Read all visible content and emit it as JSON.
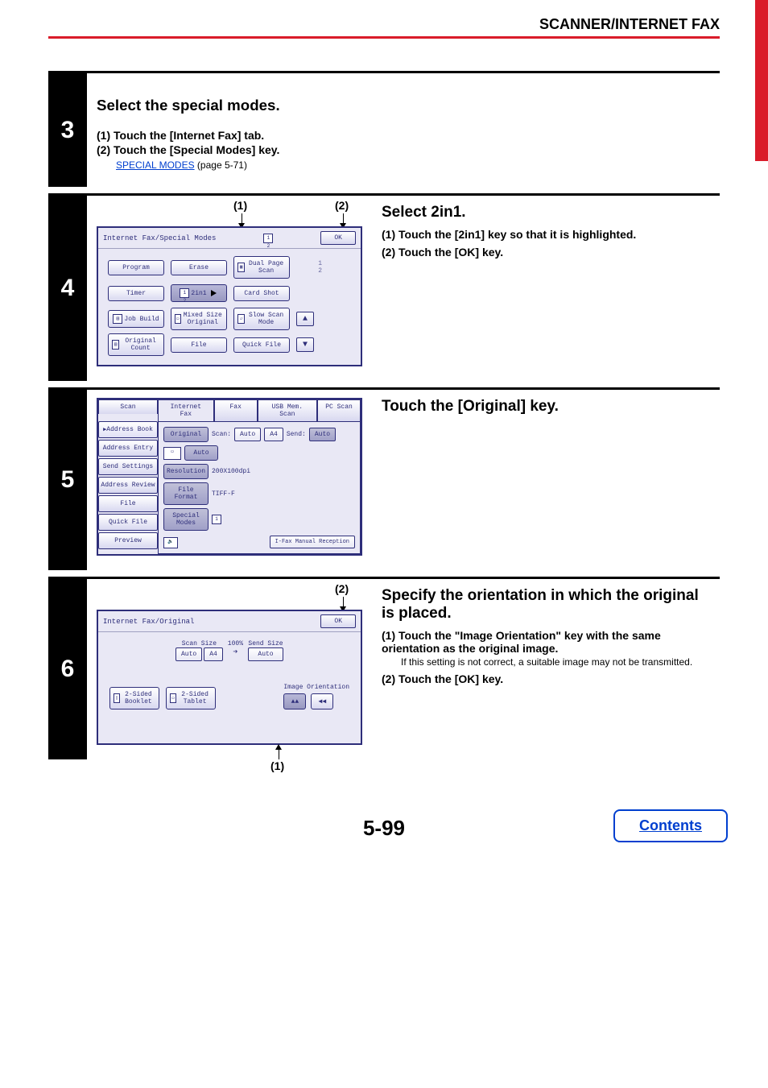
{
  "header": {
    "section": "SCANNER/INTERNET FAX"
  },
  "step3": {
    "num": "3",
    "title": "Select the special modes.",
    "sub1": "(1)  Touch the [Internet Fax] tab.",
    "sub2": "(2)  Touch the [Special Modes] key.",
    "link": "SPECIAL MODES",
    "link_after": " (page 5-71)"
  },
  "step4": {
    "num": "4",
    "callout1": "(1)",
    "callout2": "(2)",
    "right": {
      "title": "Select 2in1.",
      "sub1": "(1)  Touch the [2in1] key so that it is highlighted.",
      "sub2": "(2)  Touch the [OK] key."
    },
    "screen": {
      "title": "Internet Fax/Special Modes",
      "ok": "OK",
      "program": "Program",
      "erase": "Erase",
      "dualpage": "Dual Page Scan",
      "timer": "Timer",
      "twoin1": "2in1",
      "cardshot": "Card Shot",
      "jobbuild": "Job Build",
      "mixed": "Mixed Size Original",
      "slowscan": "Slow Scan Mode",
      "origcount": "Original Count",
      "file": "File",
      "quickfile": "Quick File",
      "pager": "1\n2"
    }
  },
  "step5": {
    "num": "5",
    "right": {
      "title": "Touch the [Original] key."
    },
    "screen": {
      "tabs": {
        "scan": "Scan",
        "ifax": "Internet Fax",
        "fax": "Fax",
        "usb": "USB Mem. Scan",
        "pc": "PC Scan"
      },
      "side": {
        "addr_book": "Address Book",
        "addr_entry": "Address Entry",
        "send_settings": "Send Settings",
        "addr_review": "Address Review",
        "file": "File",
        "quick_file": "Quick File",
        "preview": "Preview"
      },
      "rows": {
        "original": "Original",
        "scan": "Scan:",
        "auto": "Auto",
        "a4": "A4",
        "send": "Send:",
        "send_auto": "Auto",
        "exposure": "Auto",
        "resolution": "Resolution",
        "resolution_val": "200X100dpi",
        "fileformat": "File Format",
        "fileformat_val": "TIFF-F",
        "special": "Special Modes"
      },
      "reception": "I-Fax Manual Reception"
    }
  },
  "step6": {
    "num": "6",
    "callout1": "(1)",
    "callout2": "(2)",
    "right": {
      "title": "Specify the orientation in which the original is placed.",
      "sub1": "(1)  Touch the \"Image Orientation\" key with the same orientation as the original image.",
      "sub1_note": "If this setting is not correct, a suitable image may not be transmitted.",
      "sub2": "(2)  Touch the [OK] key."
    },
    "screen": {
      "title": "Internet Fax/Original",
      "ok": "OK",
      "scansize": "Scan Size",
      "scan_auto": "Auto",
      "scan_a4": "A4",
      "percent": "100%",
      "sendsize": "Send Size",
      "send_auto": "Auto",
      "image_orientation": "Image Orientation",
      "booklet": "2-Sided Booklet",
      "tablet": "2-Sided Tablet"
    }
  },
  "footer": {
    "page": "5-99",
    "contents": "Contents"
  }
}
